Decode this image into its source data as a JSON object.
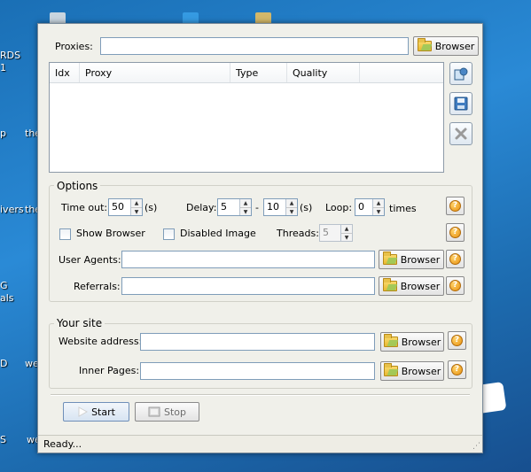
{
  "desktop": {
    "labels": [
      "RDS",
      "1",
      "p",
      "the",
      "ivers",
      "the",
      "G",
      "als",
      "D",
      "we",
      "we",
      "S",
      "W"
    ]
  },
  "proxies": {
    "label": "Proxies:",
    "value": "",
    "browse_label": "Browser"
  },
  "table": {
    "columns": [
      "Idx",
      "Proxy",
      "Type",
      "Quality"
    ]
  },
  "options": {
    "title": "Options",
    "timeout_label": "Time out:",
    "timeout_value": "50",
    "timeout_unit": "(s)",
    "delay_label": "Delay:",
    "delay_min": "5",
    "delay_sep": "-",
    "delay_max": "10",
    "delay_unit": "(s)",
    "loop_label": "Loop:",
    "loop_value": "0",
    "loop_unit": "times",
    "show_browser_label": "Show Browser",
    "disabled_image_label": "Disabled Image",
    "threads_label": "Threads:",
    "threads_value": "5",
    "user_agents_label": "User Agents:",
    "user_agents_value": "",
    "referrals_label": "Referrals:",
    "referrals_value": "",
    "browse_label": "Browser",
    "help_glyph": "?"
  },
  "site": {
    "title": "Your site",
    "website_label": "Website address:",
    "website_value": "",
    "inner_label": "Inner Pages:",
    "inner_value": "",
    "browse_label": "Browser"
  },
  "actions": {
    "start_label": "Start",
    "stop_label": "Stop"
  },
  "status": {
    "text": "Ready..."
  },
  "colors": {
    "desktop_blue": "#1d6cb0",
    "window_bg": "#f0f0ea",
    "help_orange": "#e8900e"
  }
}
